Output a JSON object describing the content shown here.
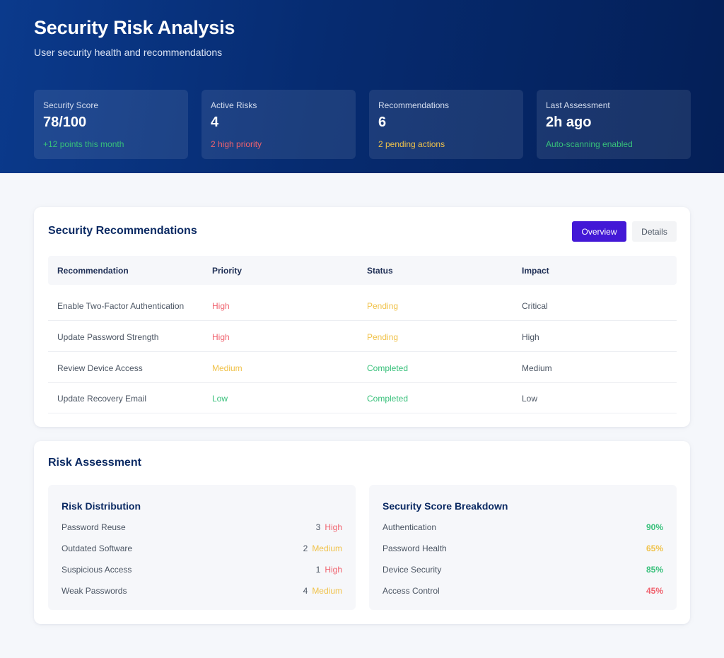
{
  "header": {
    "title": "Security Risk Analysis",
    "subtitle": "User security health and recommendations"
  },
  "stats": [
    {
      "label": "Security Score",
      "value": "78/100",
      "note": "+12 points this month",
      "note_color": "#37c07a"
    },
    {
      "label": "Active Risks",
      "value": "4",
      "note": "2 high priority",
      "note_color": "#f0626e"
    },
    {
      "label": "Recommendations",
      "value": "6",
      "note": "2 pending actions",
      "note_color": "#f0c24a"
    },
    {
      "label": "Last Assessment",
      "value": "2h ago",
      "note": "Auto-scanning enabled",
      "note_color": "#37c07a"
    }
  ],
  "recommendations": {
    "title": "Security Recommendations",
    "tabs": {
      "overview": "Overview",
      "details": "Details"
    },
    "columns": [
      "Recommendation",
      "Priority",
      "Status",
      "Impact"
    ],
    "rows": [
      {
        "recommendation": "Enable Two-Factor Authentication",
        "priority": "High",
        "priority_color": "#f0626e",
        "status": "Pending",
        "status_color": "#f0c24a",
        "impact": "Critical"
      },
      {
        "recommendation": "Update Password Strength",
        "priority": "High",
        "priority_color": "#f0626e",
        "status": "Pending",
        "status_color": "#f0c24a",
        "impact": "High"
      },
      {
        "recommendation": "Review Device Access",
        "priority": "Medium",
        "priority_color": "#f0c24a",
        "status": "Completed",
        "status_color": "#37c07a",
        "impact": "Medium"
      },
      {
        "recommendation": "Update Recovery Email",
        "priority": "Low",
        "priority_color": "#37c07a",
        "status": "Completed",
        "status_color": "#37c07a",
        "impact": "Low"
      }
    ]
  },
  "risk_assessment": {
    "title": "Risk Assessment",
    "distribution": {
      "title": "Risk Distribution",
      "items": [
        {
          "label": "Password Reuse",
          "count": "3",
          "level": "High",
          "level_color": "#f0626e"
        },
        {
          "label": "Outdated Software",
          "count": "2",
          "level": "Medium",
          "level_color": "#f0c24a"
        },
        {
          "label": "Suspicious Access",
          "count": "1",
          "level": "High",
          "level_color": "#f0626e"
        },
        {
          "label": "Weak Passwords",
          "count": "4",
          "level": "Medium",
          "level_color": "#f0c24a"
        }
      ]
    },
    "breakdown": {
      "title": "Security Score Breakdown",
      "items": [
        {
          "label": "Authentication",
          "value": "90%",
          "color": "#37c07a"
        },
        {
          "label": "Password Health",
          "value": "65%",
          "color": "#f0c24a"
        },
        {
          "label": "Device Security",
          "value": "85%",
          "color": "#37c07a"
        },
        {
          "label": "Access Control",
          "value": "45%",
          "color": "#f0626e"
        }
      ]
    }
  },
  "colors": {
    "hero_start": "#0b3a8c",
    "hero_end": "#041f57",
    "accent": "#4318d6",
    "success": "#37c07a",
    "warning": "#f0c24a",
    "danger": "#f0626e"
  }
}
